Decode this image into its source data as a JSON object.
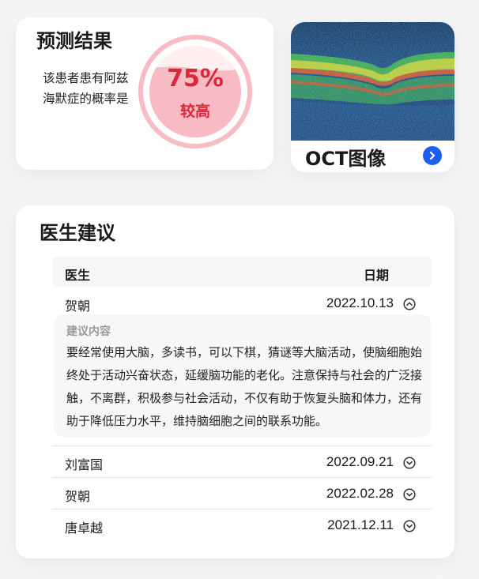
{
  "prediction": {
    "title": "预测结果",
    "description": "该患者患有阿兹海默症的概率是",
    "probability_text": "75%",
    "probability": 0.75,
    "level": "较高",
    "accent_color": "#d9283a",
    "ring_color": "#f8b9c2"
  },
  "oct": {
    "label": "OCT图像",
    "go_icon": "chevron-right-icon",
    "accent_color": "#1a5ff0"
  },
  "advice": {
    "title": "医生建议",
    "columns": {
      "doctor": "医生",
      "date": "日期"
    },
    "detail_label": "建议内容",
    "rows": [
      {
        "doctor": "贺朝",
        "date": "2022.10.13",
        "expanded": true,
        "content": "要经常使用大脑，多读书，可以下棋，猜谜等大脑活动，使脑细胞始终处于活动兴奋状态，延缓脑功能的老化。注意保持与社会的广泛接触，不离群，积极参与社会活动，不仅有助于恢复头脑和体力，还有助于降低压力水平，维持脑细胞之间的联系功能。"
      },
      {
        "doctor": "刘富国",
        "date": "2022.09.21",
        "expanded": false
      },
      {
        "doctor": "贺朝",
        "date": "2022.02.28",
        "expanded": false
      },
      {
        "doctor": "唐卓越",
        "date": "2021.12.11",
        "expanded": false
      }
    ]
  }
}
